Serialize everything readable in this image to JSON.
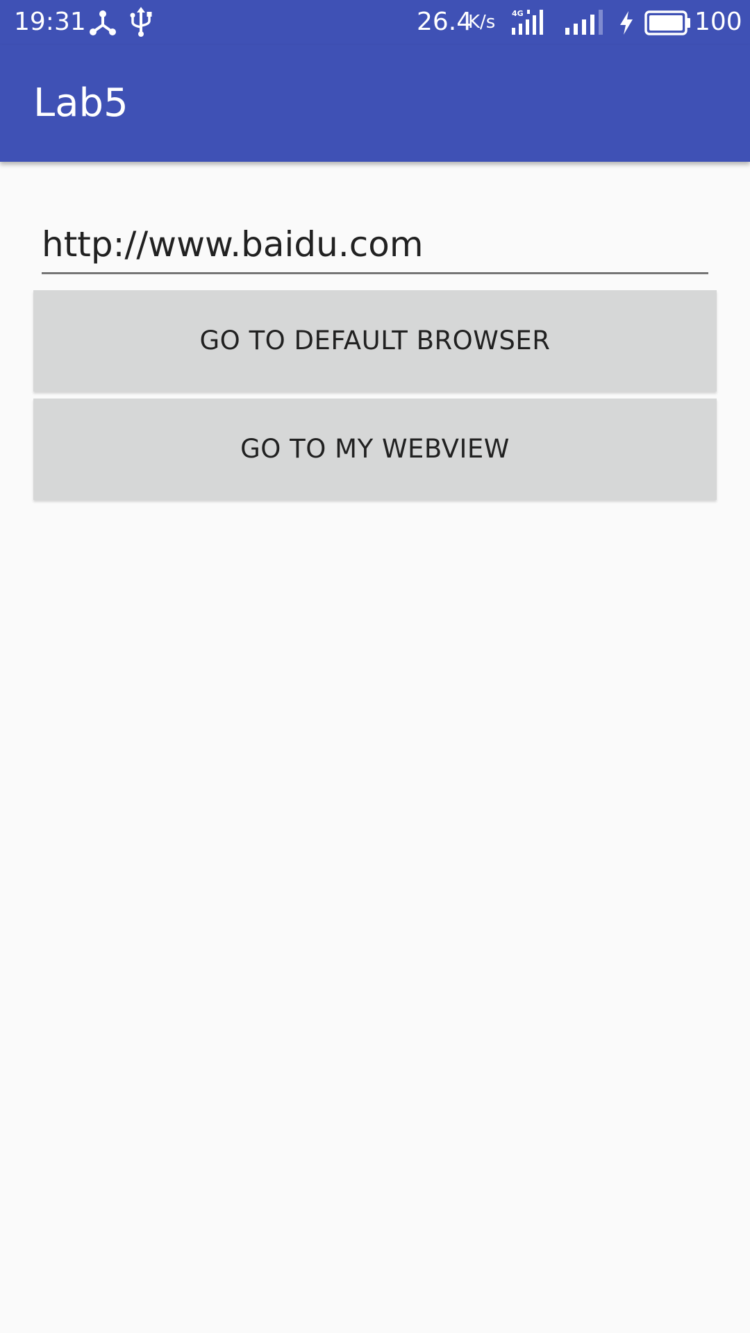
{
  "status_bar": {
    "time": "19:31",
    "network_speed": "26.4",
    "network_speed_unit": "K/s",
    "network_type": "4G",
    "battery_level": "100",
    "icons": [
      "share-icon",
      "usb-icon",
      "signal-4g-icon",
      "signal-icon",
      "charging-icon",
      "battery-icon"
    ]
  },
  "app_bar": {
    "title": "Lab5"
  },
  "main": {
    "url_input": {
      "value": "http://www.baidu.com"
    },
    "default_browser_button": "GO TO DEFAULT BROWSER",
    "webview_button": "GO TO MY WEBVIEW"
  },
  "colors": {
    "primary": "#3f51b5",
    "background": "#fafafa",
    "button": "#d6d7d7"
  }
}
